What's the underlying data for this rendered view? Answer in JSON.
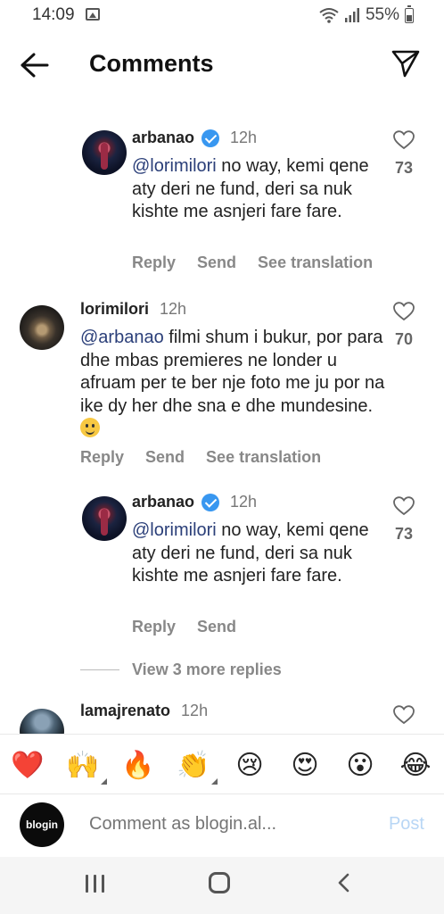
{
  "status_bar": {
    "time": "14:09",
    "battery": "55%"
  },
  "header": {
    "title": "Comments"
  },
  "comments": [
    {
      "user": "arbanao",
      "verified": true,
      "time": "12h",
      "mention": "@lorimilori",
      "text": " no way, kemi qene aty deri ne fund, deri sa nuk kishte me asnjeri fare fare.",
      "actions": [
        "Reply",
        "Send",
        "See translation"
      ],
      "likes": "73"
    },
    {
      "user": "lorimilori",
      "verified": false,
      "time": "12h",
      "mention": "@arbanao",
      "text": " filmi shum i bukur, por para dhe mbas premieres ne londer u afruam per te ber nje foto me ju por na ike dy her dhe sna e dhe mundesine.",
      "actions": [
        "Reply",
        "Send",
        "See translation"
      ],
      "likes": "70"
    },
    {
      "user": "arbanao",
      "verified": true,
      "time": "12h",
      "mention": "@lorimilori",
      "text": " no way, kemi qene aty deri ne fund, deri sa nuk kishte me asnjeri fare fare.",
      "actions": [
        "Reply",
        "Send"
      ],
      "likes": "73"
    },
    {
      "user": "lamajrenato",
      "verified": false,
      "time": "12h"
    }
  ],
  "view_more": "View 3 more replies",
  "emoji_bar": [
    "❤️",
    "🙌",
    "🔥",
    "👏",
    "😢",
    "😍",
    "😮",
    "😂"
  ],
  "comment_bar": {
    "avatar_text": "blogin",
    "placeholder": "Comment as blogin.al...",
    "post": "Post"
  }
}
